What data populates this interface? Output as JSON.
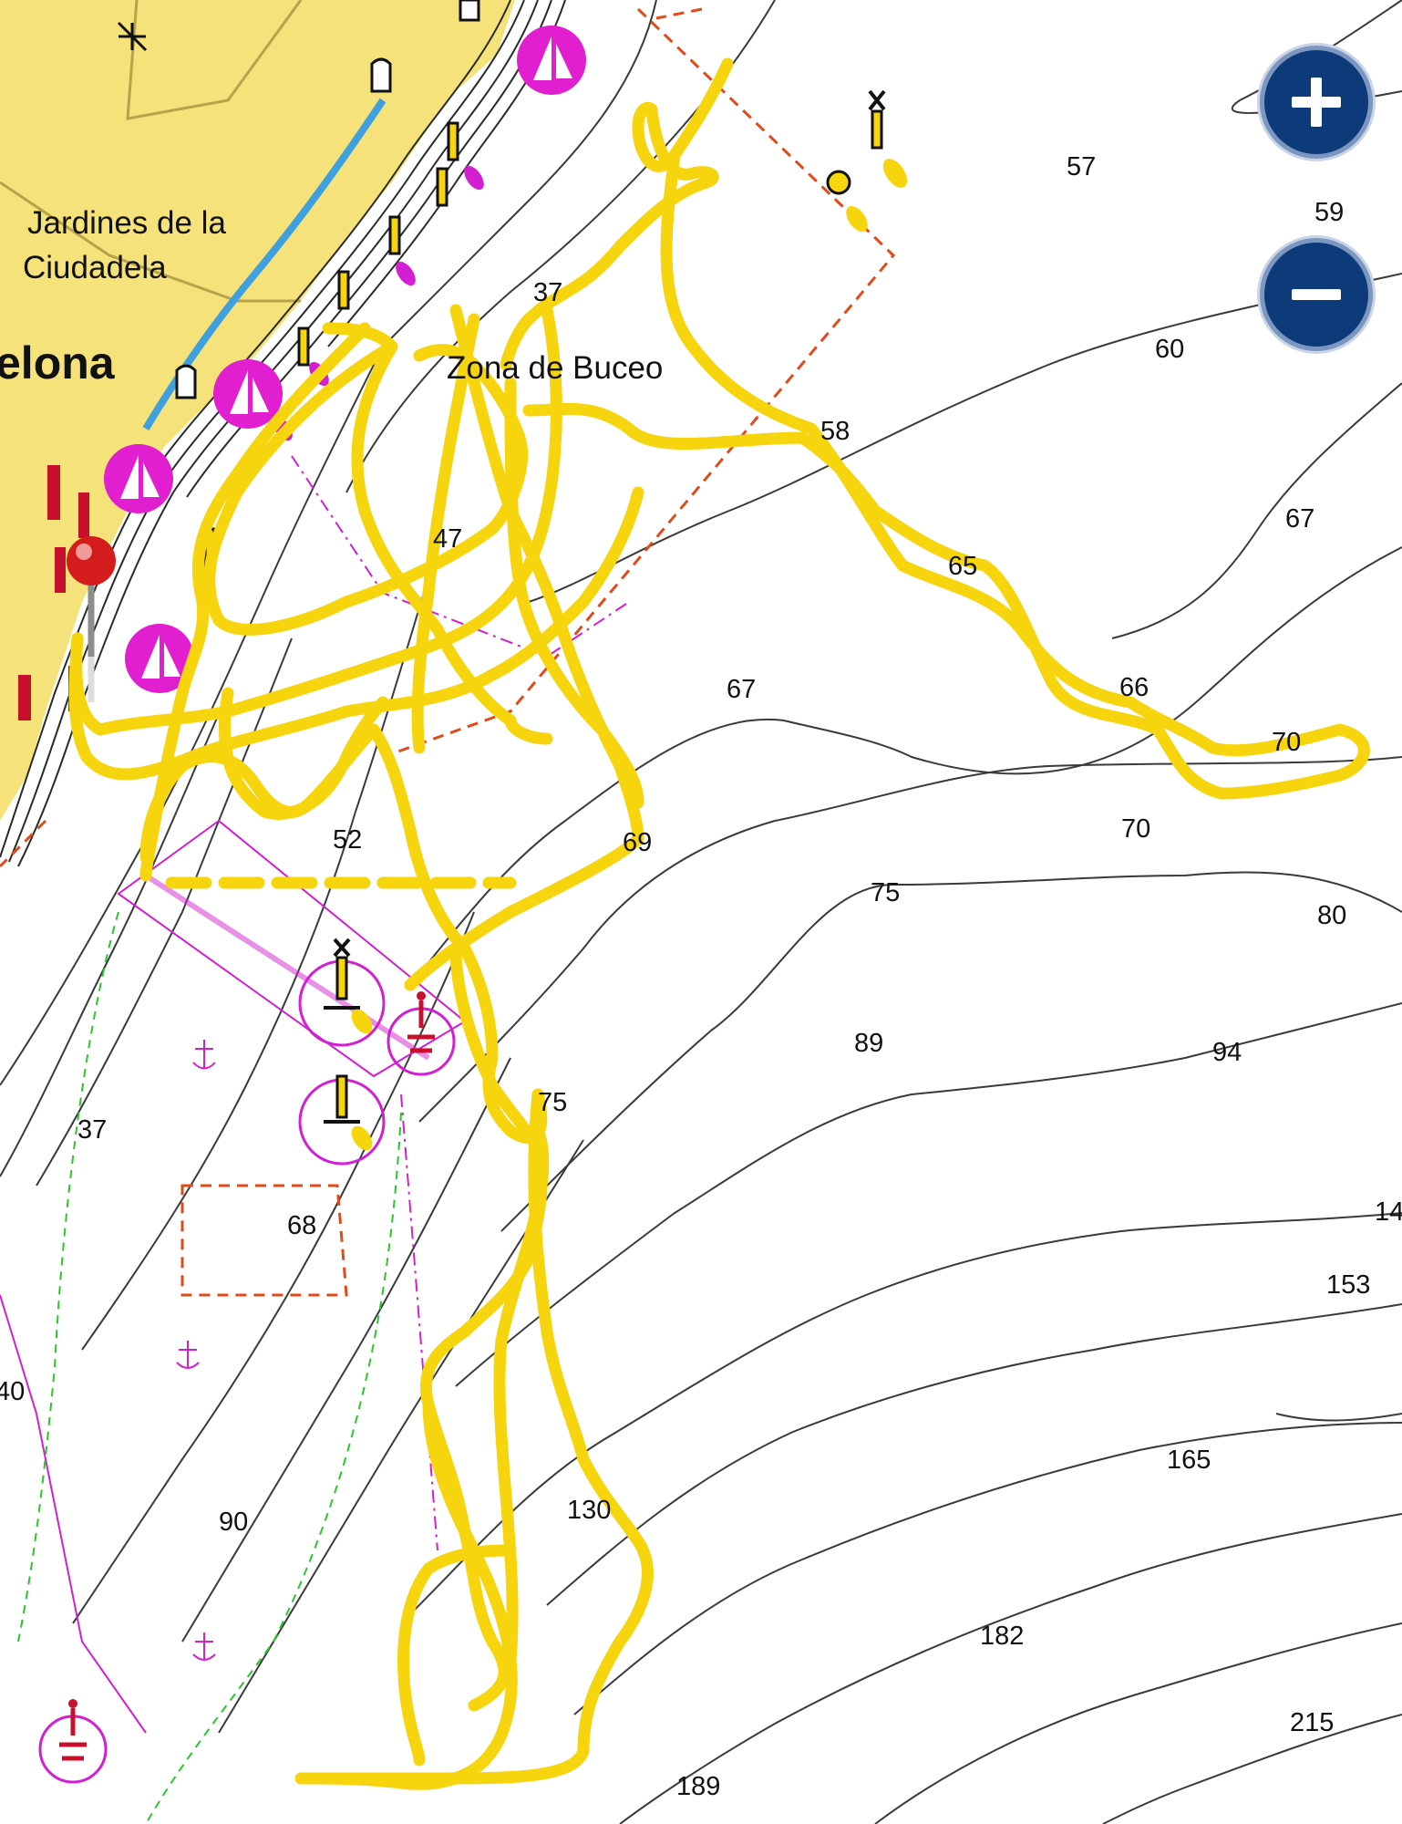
{
  "map": {
    "labels": {
      "place_jardines_1": "Jardines de la",
      "place_jardines_2": "Ciudadela",
      "place_city": "elona",
      "place_zona": "Zona de Buceo"
    },
    "soundings": {
      "d57": "57",
      "d59": "59",
      "d37a": "37",
      "d60": "60",
      "d58": "58",
      "d67a": "67",
      "d47": "47",
      "d65": "65",
      "d67b": "67",
      "d66": "66",
      "d70a": "70",
      "d70b": "70",
      "d52": "52",
      "d69": "69",
      "d75": "75",
      "d80": "80",
      "d89": "89",
      "d94": "94",
      "d75b": "75",
      "d37b": "37",
      "d68": "68",
      "d14x": "14",
      "d153": "153",
      "d40": "40",
      "d165": "165",
      "d90": "90",
      "d130": "130",
      "d182": "182",
      "d215": "215",
      "d189": "189"
    },
    "colors": {
      "land": "#f5e27a",
      "water": "#ffffff",
      "track": "#f6d40e",
      "contour": "#3a3a3a",
      "restricted": "#e24a1a",
      "magenta": "#d21fd2",
      "route_green": "#28c828",
      "zoom_button": "#0d3a78"
    }
  },
  "controls": {
    "zoom_in_icon": "plus-icon",
    "zoom_out_icon": "minus-icon"
  },
  "marker": {
    "icon": "red-pin-icon"
  }
}
